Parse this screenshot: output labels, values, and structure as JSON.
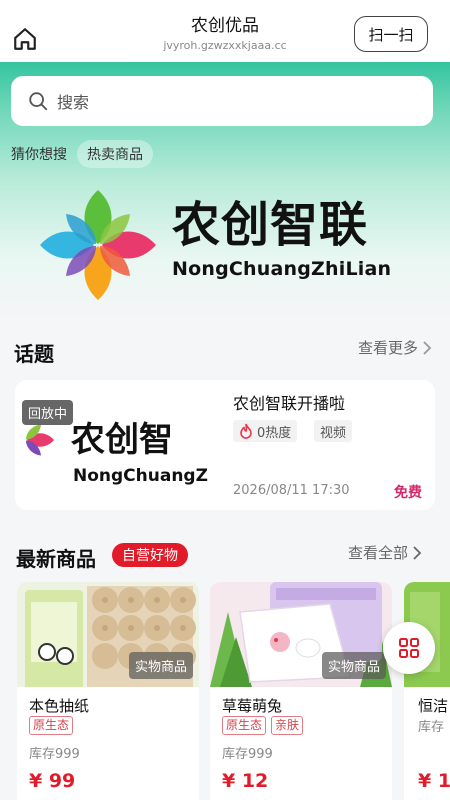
{
  "header": {
    "title": "农创优品",
    "domain": "jvyroh.gzwzxxkjaaa.cc",
    "scan_label": "扫一扫",
    "home_icon": "home-icon"
  },
  "search": {
    "placeholder": "搜索",
    "icon": "search-icon"
  },
  "guess": {
    "label": "猜你想搜",
    "hot_tag": "热卖商品"
  },
  "brand": {
    "name_cn": "农创智联",
    "name_en": "NongChuangZhiLian",
    "colors": [
      "#e83a6d",
      "#35b6e0",
      "#5bbf3c",
      "#f6a51c",
      "#7c4bb8"
    ]
  },
  "topics": {
    "title": "话题",
    "more": "查看更多",
    "card": {
      "badge": "回放中",
      "thumb_cn": "农创智",
      "thumb_en": "NongChuangZ",
      "title": "农创智联开播啦",
      "heat": "0热度",
      "tag": "视频",
      "date": "2026/08/11 17:30",
      "price": "免费"
    }
  },
  "products": {
    "title": "最新商品",
    "badge": "自营好物",
    "more": "查看全部",
    "items": [
      {
        "name": "本色抽纸",
        "tags": [
          "原生态"
        ],
        "stock": "库存999",
        "price": "¥ 99",
        "type_tag": "实物商品"
      },
      {
        "name": "草莓萌兔",
        "tags": [
          "原生态",
          "亲肤"
        ],
        "stock": "库存999",
        "price": "¥ 12",
        "type_tag": "实物商品"
      },
      {
        "name": "恒洁",
        "tags": [],
        "stock": "库存",
        "price": "¥ 1",
        "type_tag": ""
      }
    ]
  },
  "fab_icon": "grid-icon",
  "accent": "#e21b2a"
}
